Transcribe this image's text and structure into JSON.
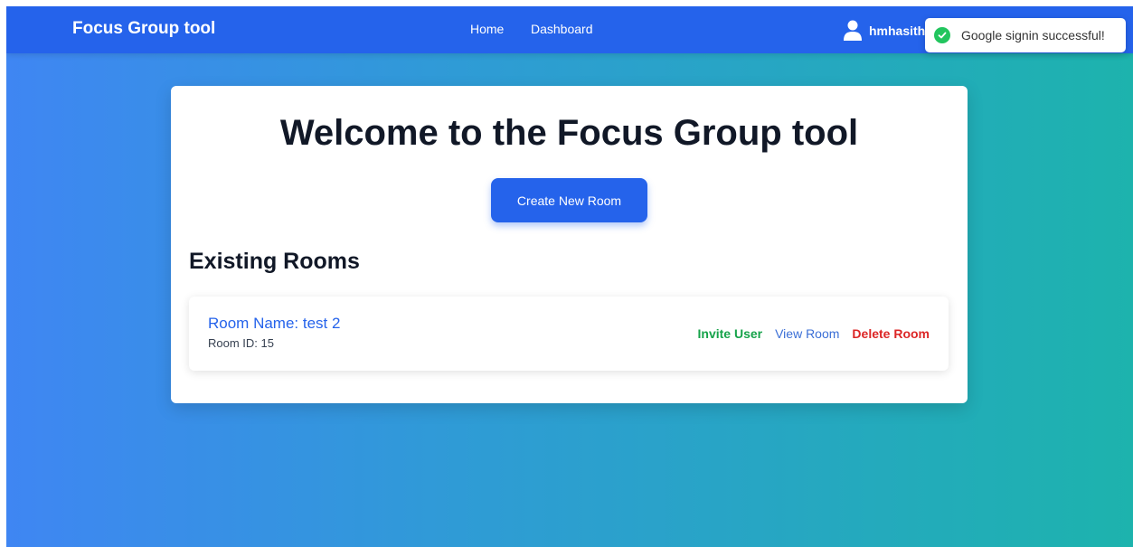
{
  "navbar": {
    "brand": "Focus Group tool",
    "links": [
      "Home",
      "Dashboard"
    ],
    "user": {
      "name": "hmhasith",
      "icon": "user-icon"
    }
  },
  "toast": {
    "icon": "check-circle-icon",
    "message": "Google signin successful!",
    "color": "#22c55e"
  },
  "main": {
    "title": "Welcome to the Focus Group tool",
    "create_button": "Create New Room",
    "section_title": "Existing Rooms",
    "rooms": [
      {
        "name": "Room Name: test 2",
        "id": "Room ID: 15",
        "actions": {
          "invite": "Invite User",
          "view": "View Room",
          "delete": "Delete Room"
        }
      }
    ]
  },
  "colors": {
    "primary": "#2563eb",
    "invite": "#16a34a",
    "delete": "#dc2626"
  }
}
